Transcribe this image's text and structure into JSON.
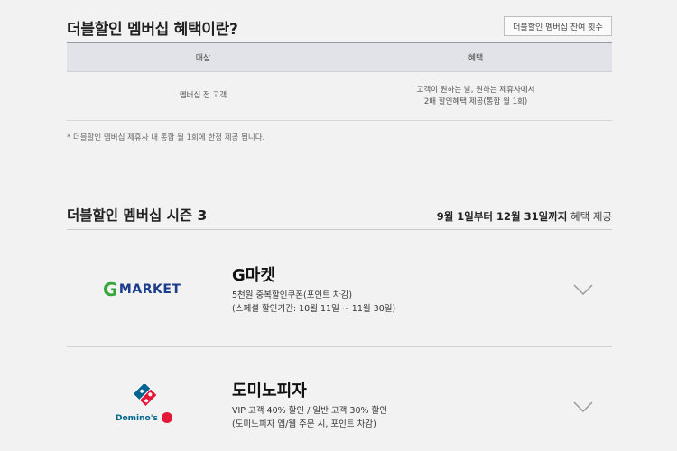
{
  "section1": {
    "title": "더블할인 멤버십 혜택이란?",
    "count_button": "더블할인 멤버십 잔여 횟수",
    "table": {
      "headers": [
        "대상",
        "혜택"
      ],
      "rows": [
        {
          "target": "멤버십 전 고객",
          "benefit_line1": "고객이 원하는 날, 원하는 제휴사에서",
          "benefit_line2": "2배 할인혜택 제공(통합 월 1회)"
        }
      ]
    },
    "note": "* 더블할인 멤버십 제휴사 내 통합 월 1회에 한정 제공 됩니다."
  },
  "section2": {
    "title": "더블할인 멤버십 시즌 3",
    "period_bold": "9월 1일부터 12월 31일까지",
    "period_light": " 혜택 제공",
    "partners": [
      {
        "logo_text": "MARKET",
        "logo_letter": "G",
        "name": "G마켓",
        "desc_line1": "5천원 중복할인쿠폰(포인트 차감)",
        "desc_line2": "(스페셜 할인기간: 10월 11일 ~ 11월 30일)"
      },
      {
        "logo_text": "Domino's",
        "name": "도미노피자",
        "desc_line1": "VIP 고객 40% 할인 / 일반 고객 30% 할인",
        "desc_line2": "(도미노피자 앱/웹 주문 시, 포인트 차감)"
      }
    ]
  },
  "colors": {
    "accent_blue": "#1c3c8c",
    "gmarket_green": "#36a63c",
    "dominos_red": "#e31837",
    "dominos_blue": "#006491"
  }
}
